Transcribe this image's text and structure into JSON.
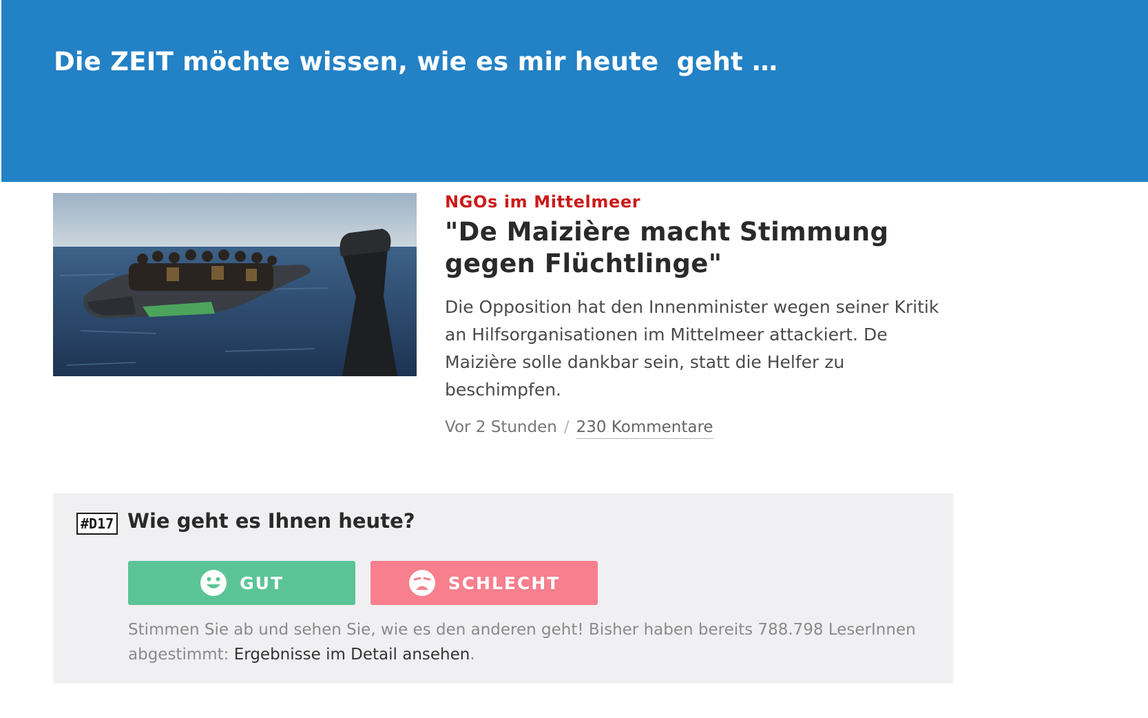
{
  "banner": {
    "title": "Die ZEIT möchte wissen, wie es mir heute  geht …",
    "background": "#2381c5"
  },
  "teaser": {
    "image_icon": "refugee-boat-photo",
    "kicker": "NGOs im Mittelmeer",
    "headline": "\"De Maizière macht Stimmung gegen Flüchtlinge\"",
    "summary": "Die Opposition hat den Innenminister wegen seiner Kritik an Hilfsorganisationen im Mittelmeer attackiert. De Maizière solle dankbar sein, statt die Helfer zu beschimpfen.",
    "time": "Vor 2 Stunden",
    "separator": "/",
    "comments": "230 Kommentare",
    "kicker_color": "#cc1a1a"
  },
  "poll": {
    "tag": "#D17",
    "title": "Wie geht es Ihnen heute?",
    "good_label": "GUT",
    "bad_label": "SCHLECHT",
    "good_icon": "smiley-happy-icon",
    "bad_icon": "smiley-sad-icon",
    "good_color": "#5bc497",
    "bad_color": "#f77f8e",
    "note": "Stimmen Sie ab und sehen Sie, wie es den anderen geht! Bisher haben bereits 788.798 LeserInnen abgestimmt: ",
    "detail_link": "Ergebnisse im Detail ansehen",
    "note_end": "."
  }
}
